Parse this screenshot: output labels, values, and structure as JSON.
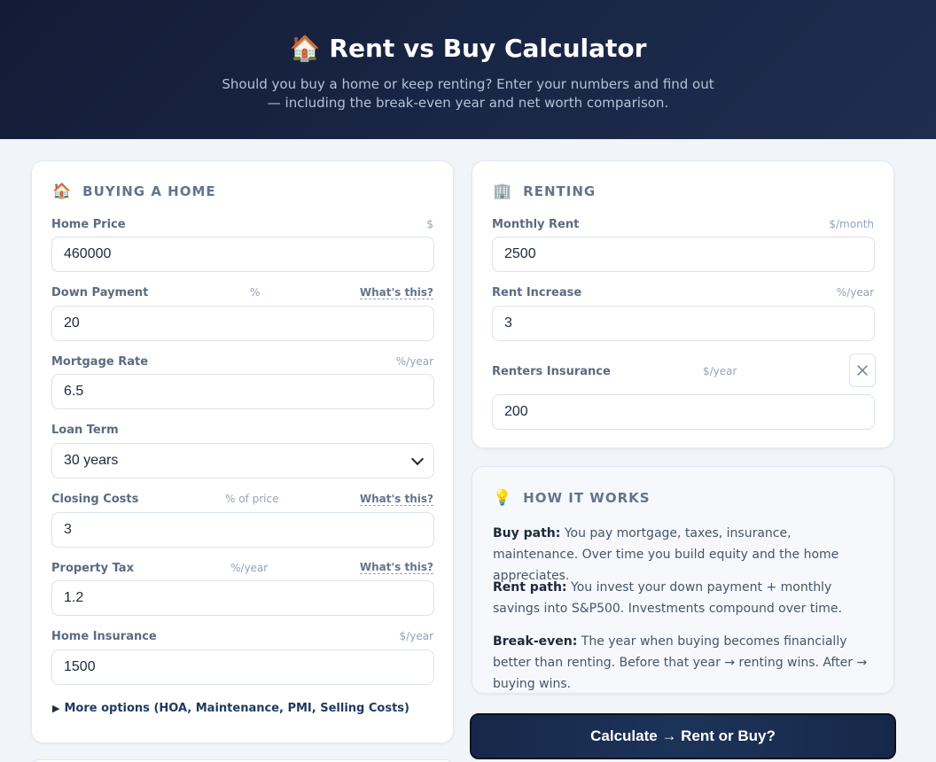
{
  "header": {
    "title_icon": "🏠",
    "title": "Rent vs Buy Calculator",
    "subtitle": "Should you buy a home or keep renting? Enter your numbers and find out — including the break-even year and net worth comparison."
  },
  "buy": {
    "icon": "🏠",
    "heading": "BUYING A HOME",
    "whats_this": "What's this?",
    "fields": {
      "home_price": {
        "label": "Home Price",
        "unit": "$",
        "value": "460000"
      },
      "down_payment": {
        "label": "Down Payment",
        "unit": "%",
        "value": "20"
      },
      "mortgage_rate": {
        "label": "Mortgage Rate",
        "unit": "%/year",
        "value": "6.5"
      },
      "loan_term": {
        "label": "Loan Term",
        "value": "30 years"
      },
      "closing_costs": {
        "label": "Closing Costs",
        "unit": "% of price",
        "value": "3"
      },
      "property_tax": {
        "label": "Property Tax",
        "unit": "%/year",
        "value": "1.2"
      },
      "home_insurance": {
        "label": "Home Insurance",
        "unit": "$/year",
        "value": "1500"
      }
    },
    "more_options": "More options (HOA, Maintenance, PMI, Selling Costs)"
  },
  "rent": {
    "icon": "🏢",
    "heading": "RENTING",
    "fields": {
      "monthly_rent": {
        "label": "Monthly Rent",
        "unit": "$/month",
        "value": "2500"
      },
      "rent_increase": {
        "label": "Rent Increase",
        "unit": "%/year",
        "value": "3"
      },
      "renters_insurance": {
        "label": "Renters Insurance",
        "unit": "$/year",
        "value": "200"
      }
    }
  },
  "how": {
    "icon": "💡",
    "heading": "HOW IT WORKS",
    "items": [
      {
        "title": "Buy path:",
        "text": " You pay mortgage, taxes, insurance, maintenance. Over time you build equity and the home appreciates."
      },
      {
        "title": "Rent path:",
        "text": " You invest your down payment + monthly savings into S&P500. Investments compound over time."
      },
      {
        "title": "Break-even:",
        "text": " The year when buying becomes financially better than renting. Before that year → renting wins. After → buying wins."
      }
    ]
  },
  "calculate_label": "Calculate → Rent or Buy?"
}
